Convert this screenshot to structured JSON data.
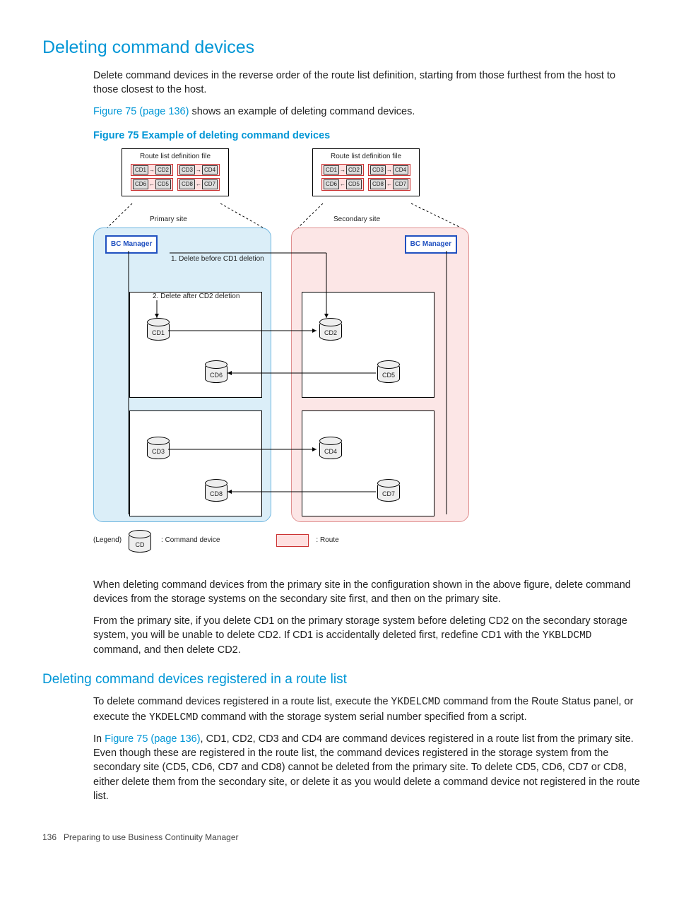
{
  "h1": "Deleting command devices",
  "para1": "Delete command devices in the reverse order of the route list definition, starting from those furthest from the host to those closest to the host.",
  "xref1": "Figure 75 (page 136)",
  "para2_tail": " shows an example of deleting command devices.",
  "fig_caption": "Figure 75 Example of deleting command devices",
  "diagram": {
    "route_file_label": "Route list definition file",
    "cd_pairs_row1": [
      [
        "CD1",
        "CD2"
      ],
      [
        "CD3",
        "CD4"
      ]
    ],
    "cd_pairs_row2": [
      [
        "CD6",
        "CD5"
      ],
      [
        "CD8",
        "CD7"
      ]
    ],
    "primary_label": "Primary site",
    "secondary_label": "Secondary site",
    "bc_mgr": "BC Manager",
    "note1": "1. Delete before CD1 deletion",
    "note2": "2. Delete after CD2 deletion",
    "cds": {
      "cd1": "CD1",
      "cd2": "CD2",
      "cd3": "CD3",
      "cd4": "CD4",
      "cd5": "CD5",
      "cd6": "CD6",
      "cd7": "CD7",
      "cd8": "CD8"
    },
    "legend_label": "(Legend)",
    "legend_cd": "CD",
    "legend_cd_text": ": Command device",
    "legend_route_text": ": Route"
  },
  "para3": "When deleting command devices from the primary site in the configuration shown in the above figure, delete command devices from the storage systems on the secondary site first, and then on the primary site.",
  "para4_a": "From the primary site, if you delete CD1 on the primary storage system before deleting CD2 on the secondary storage system, you will be unable to delete CD2. If CD1 is accidentally deleted first, redefine CD1 with the ",
  "para4_code": "YKBLDCMD",
  "para4_b": " command, and then delete CD2.",
  "h2": "Deleting command devices registered in a route list",
  "para5_a": "To delete command devices registered in a route list, execute the ",
  "para5_code1": "YKDELCMD",
  "para5_b": " command from the Route Status panel, or execute the ",
  "para5_code2": "YKDELCMD",
  "para5_c": " command with the storage system serial number specified from a script.",
  "para6_a": "In ",
  "xref2": "Figure 75 (page 136)",
  "para6_b": ", CD1, CD2, CD3 and CD4 are command devices registered in a route list from the primary site. Even though these are registered in the route list, the command devices registered in the storage system from the secondary site (CD5, CD6, CD7 and CD8) cannot be deleted from the primary site. To delete CD5, CD6, CD7 or CD8, either delete them from the secondary site, or delete it as you would delete a command device not registered in the route list.",
  "footer_page": "136",
  "footer_text": "Preparing to use Business Continuity Manager"
}
